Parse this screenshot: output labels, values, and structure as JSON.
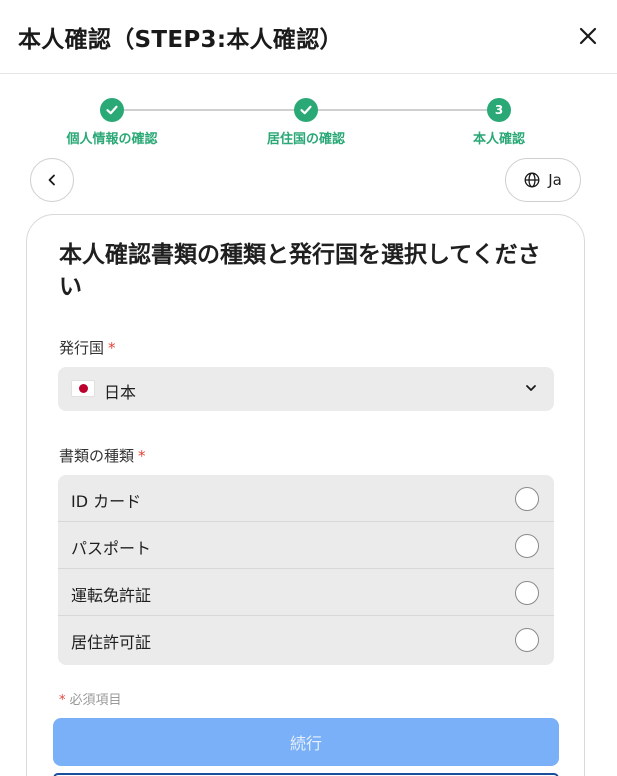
{
  "header": {
    "title": "本人確認（STEP3:本人確認）",
    "close_icon": "close-icon"
  },
  "stepper": {
    "steps": [
      {
        "label": "個人情報の確認",
        "state": "completed",
        "icon": "check-icon"
      },
      {
        "label": "居住国の確認",
        "state": "completed",
        "icon": "check-icon"
      },
      {
        "label": "本人確認",
        "state": "current",
        "number": "3"
      }
    ],
    "accent_color": "#2aa876"
  },
  "nav": {
    "back_icon": "chevron-left-icon",
    "language_label": "Ja",
    "language_icon": "globe-icon"
  },
  "form": {
    "title": "本人確認書類の種類と発行国を選択してください",
    "country": {
      "label": "発行国",
      "required_mark": "*",
      "value": "日本",
      "flag_icon": "japan-flag-icon"
    },
    "document_type": {
      "label": "書類の種類",
      "required_mark": "*",
      "options": [
        {
          "label": "ID カード",
          "selected": false
        },
        {
          "label": "パスポート",
          "selected": false
        },
        {
          "label": "運転免許証",
          "selected": false
        },
        {
          "label": "居住許可証",
          "selected": false
        }
      ]
    },
    "required_note": {
      "mark": "*",
      "text": "必須項目"
    },
    "continue_label": "続行",
    "continue_color": "#7ab0f7",
    "required_color": "#e0453a"
  }
}
